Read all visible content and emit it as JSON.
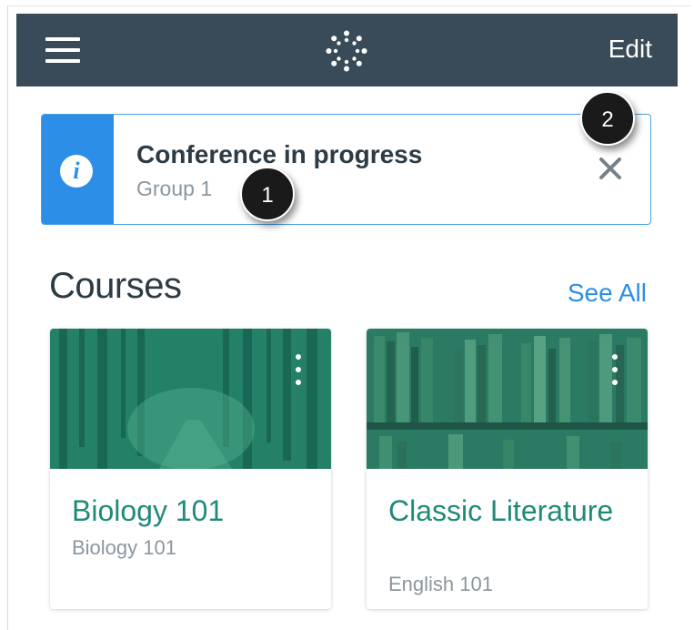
{
  "navbar": {
    "edit_label": "Edit",
    "background": "#394b58",
    "icons": [
      "hamburger-icon",
      "canvas-logo-icon"
    ]
  },
  "announcement": {
    "title": "Conference in progress",
    "subtitle": "Group 1",
    "accent": "#2d8ee7",
    "icons": [
      "info-icon",
      "close-icon"
    ]
  },
  "callouts": [
    "1",
    "2"
  ],
  "courses": {
    "heading": "Courses",
    "see_all_label": "See All",
    "items": [
      {
        "title": "Biology 101",
        "code": "Biology 101",
        "color": "#1f8a78",
        "image": "forest-photo"
      },
      {
        "title": "Classic Literature",
        "code": "English 101",
        "color": "#1f8a78",
        "image": "bookshelf-photo"
      }
    ]
  }
}
